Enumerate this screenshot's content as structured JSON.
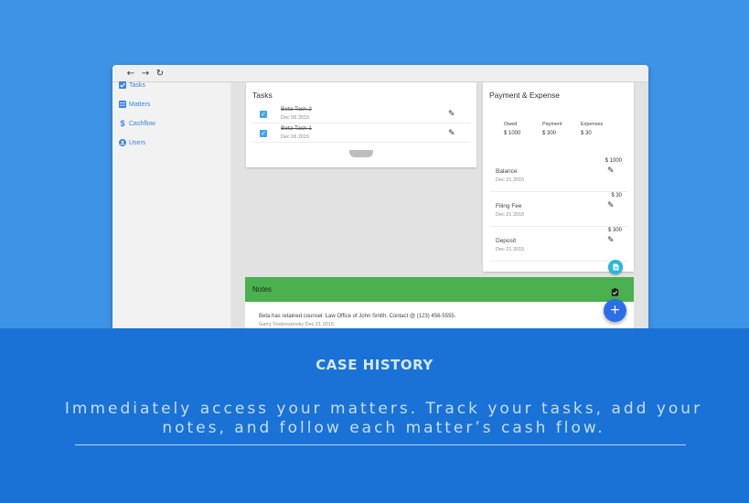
{
  "browser": {
    "nav": [
      {
        "name": "back-arrow-icon",
        "glyph": "←"
      },
      {
        "name": "forward-arrow-icon",
        "glyph": "→"
      },
      {
        "name": "reload-icon",
        "glyph": "↻"
      }
    ]
  },
  "sidebar": {
    "items": [
      {
        "label": "Tasks",
        "icon": "checkbox-icon"
      },
      {
        "label": "Matters",
        "icon": "list-icon"
      },
      {
        "label": "Cashflow",
        "icon": "dollar-icon"
      },
      {
        "label": "Users",
        "icon": "user-icon"
      }
    ]
  },
  "tasks": {
    "title": "Tasks",
    "items": [
      {
        "name": "Beta Task 2",
        "date": "Dec 06 2015",
        "done": true
      },
      {
        "name": "Beta Task 1",
        "date": "Dec 06 2015",
        "done": true
      }
    ]
  },
  "payment": {
    "title": "Payment & Expense",
    "summary": [
      {
        "label": "Owed",
        "value": "$ 1000"
      },
      {
        "label": "Payment",
        "value": "$ 300"
      },
      {
        "label": "Expenses",
        "value": "$ 30"
      }
    ],
    "entries": [
      {
        "label": "Balance",
        "date": "Dec 21 2015",
        "amount": "$ 1000"
      },
      {
        "label": "Filing Fee",
        "date": "Dec 21 2015",
        "amount": "$ 30"
      },
      {
        "label": "Deposit",
        "date": "Dec 21 2015",
        "amount": "$ 300"
      }
    ]
  },
  "notes": {
    "title": "Notes",
    "items": [
      {
        "text": "Beta has retained counsel: Law Office of John Smith. Contact @ (123) 456-5555.",
        "meta": "Garry Voskresensky Dec 21 2015"
      }
    ]
  },
  "promo": {
    "headline": "CASE HISTORY",
    "tagline": "Immediately access your matters. Track your tasks, add your notes, and follow each matter’s cash flow."
  },
  "colors": {
    "background": "#3d93e6",
    "band": "#1a72d6",
    "notes_header": "#4bb04e",
    "accent_fab": "#2a6ee8",
    "accent_small_fab": "#27b9d8",
    "checkbox": "#41a6e6"
  }
}
